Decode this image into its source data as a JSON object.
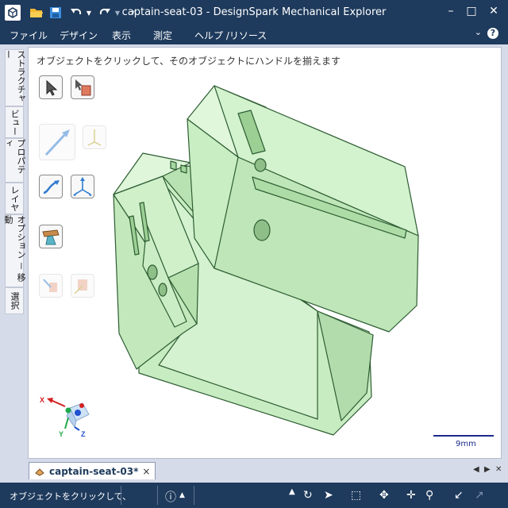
{
  "window": {
    "title": "captain-seat-03 - DesignSpark Mechanical Explorer",
    "minimize": "–",
    "maximize": "□",
    "close": "✕"
  },
  "menu": {
    "items": [
      "ファイル",
      "デザイン",
      "表示",
      "測定",
      "ヘルプ /リソース"
    ]
  },
  "side_tabs": [
    "ストラクチャー",
    "ビュー",
    "プロパティ",
    "レイヤ",
    "オプション － 移動",
    "選択"
  ],
  "viewport": {
    "hint": "オブジェクトをクリックして、そのオブジェクトにハンドルを揃えます",
    "scale_label": "9mm",
    "triad": {
      "x": "X",
      "y": "Y",
      "z": "Z"
    }
  },
  "document_tab": {
    "label": "captain-seat-03*"
  },
  "status": {
    "message": "オブジェクトをクリックして、"
  },
  "colors": {
    "chrome": "#1e3a5c",
    "model_fill": "#c6ebc0",
    "model_edge": "#2e5d33",
    "accent": "#1b2a8a"
  },
  "icons": [
    "app-icon",
    "open-folder-icon",
    "save-icon",
    "undo-icon",
    "redo-icon",
    "select-arrow-icon",
    "select-component-icon",
    "pull-arrow-icon",
    "move-icon",
    "anchor-icon",
    "info-icon",
    "rotate-view-icon",
    "zoom-icon",
    "pan-icon"
  ]
}
